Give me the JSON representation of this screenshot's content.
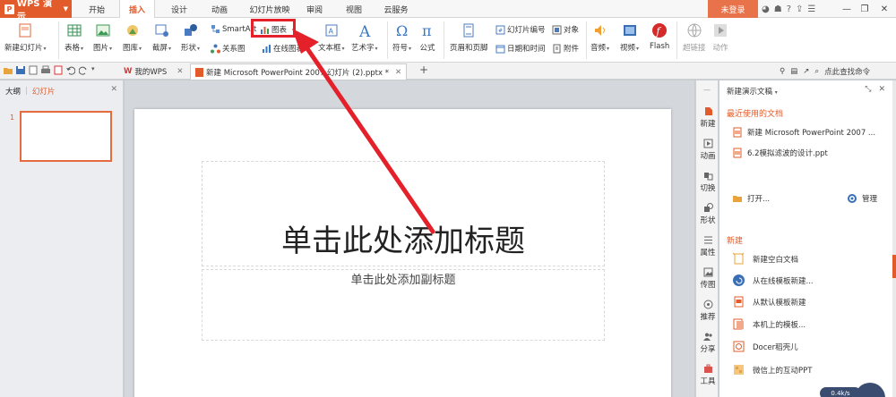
{
  "app": {
    "name": "WPS 演示",
    "accent": "#e25c2b"
  },
  "menu_tabs": [
    "开始",
    "插入",
    "设计",
    "动画",
    "幻灯片放映",
    "审阅",
    "视图",
    "云服务"
  ],
  "active_tab": "插入",
  "login_label": "未登录",
  "ribbon": {
    "new_slide": "新建幻灯片",
    "table": "表格",
    "picture": "图片",
    "gallery": "图库",
    "screenshot": "截屏",
    "shape": "形状",
    "smartart": "SmartArt",
    "chart": "图表",
    "relation_chart": "关系图",
    "online_chart": "在线图表",
    "textbox": "文本框",
    "wordart": "艺术字",
    "symbol": "符号",
    "formula": "公式",
    "header_footer": "页眉和页脚",
    "slide_number": "幻灯片编号",
    "date_time": "日期和时间",
    "object": "对象",
    "attachment": "附件",
    "audio": "音频",
    "video": "视频",
    "flash": "Flash",
    "hyperlink": "超链接",
    "action": "动作"
  },
  "doc_tabs": {
    "mywps": "我的WPS",
    "current": "新建 Microsoft PowerPoint 2007 幻灯片 (2).pptx *"
  },
  "find_command": "点此查找命令",
  "left_pane": {
    "outline": "大纲",
    "slides": "幻灯片",
    "slide_number": "1"
  },
  "slide": {
    "title_placeholder": "单击此处添加标题",
    "subtitle_placeholder": "单击此处添加副标题"
  },
  "side_tools": [
    "新建",
    "动画",
    "切换",
    "形状",
    "属性",
    "传图",
    "推荐",
    "分享",
    "工具"
  ],
  "task_pane": {
    "header": "新建演示文稿",
    "recent_title": "最近使用的文档",
    "recent_docs": [
      "新建 Microsoft PowerPoint 2007 ...",
      "6.2模拟滤波的设计.ppt"
    ],
    "open": "打开...",
    "manage": "管理",
    "new_title": "新建",
    "new_items": [
      "新建空白文档",
      "从在线模板新建...",
      "从默认模板新建",
      "本机上的模板...",
      "Docer稻壳儿",
      "微信上的互动PPT"
    ]
  },
  "annotation": {
    "color": "#e4202a"
  },
  "bubble_text": "0.4k/s"
}
